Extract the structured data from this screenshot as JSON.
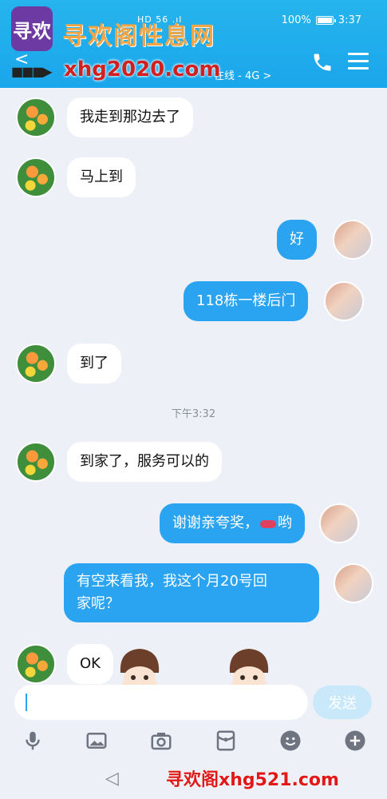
{
  "status": {
    "battery": "100%",
    "time": "3:37",
    "signal": "HD 56 .ıl"
  },
  "watermark": {
    "logo_text": "寻欢",
    "title": "寻欢阁性息网",
    "url": "xhg2020.com",
    "bottom": "寻欢阁xhg521.com"
  },
  "header": {
    "back_glyph": "<",
    "online_status": "在线 - 4G >"
  },
  "messages": [
    {
      "side": "left",
      "text": "我走到那边去了"
    },
    {
      "side": "left",
      "text": "马上到"
    },
    {
      "side": "right",
      "text": "好"
    },
    {
      "side": "right",
      "text": "118栋一楼后门"
    },
    {
      "side": "left",
      "text": "到了"
    },
    {
      "side": "left",
      "text": "到家了，服务可以的"
    },
    {
      "side": "right",
      "text_before": "谢谢亲夸奖，",
      "text_after": "哟",
      "emoji": "lips-emoji"
    },
    {
      "side": "right",
      "line1": "有空来看我，我这个月20号回",
      "line2": "家呢？"
    },
    {
      "side": "left",
      "text": "OK"
    }
  ],
  "timestamp": "下午3:32",
  "input": {
    "value": "",
    "send_label": "发送"
  },
  "toolbar": [
    "microphone-icon",
    "image-icon",
    "camera-icon",
    "red-packet-icon",
    "emoji-icon",
    "plus-icon"
  ],
  "colors": {
    "header": "#1aa6ea",
    "outgoing_bubble": "#2aa3f0",
    "background": "#eef0f8"
  }
}
